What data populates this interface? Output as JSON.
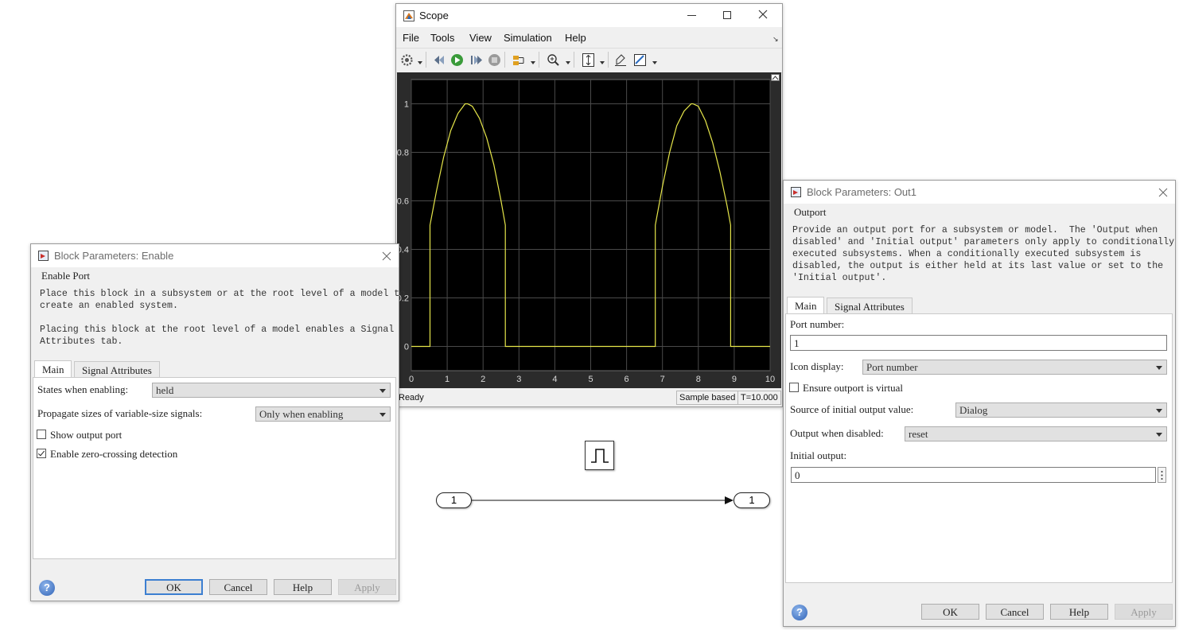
{
  "scope": {
    "title": "Scope",
    "menu": [
      "File",
      "Tools",
      "View",
      "Simulation",
      "Help"
    ],
    "status_left": "Ready",
    "status_mode": "Sample based",
    "status_time": "T=10.000"
  },
  "enable_dialog": {
    "title": "Block Parameters: Enable",
    "group": "Enable Port",
    "desc1": "Place this block in a subsystem or at the root level of a model to\ncreate an enabled system.",
    "desc2": "Placing this block at the root level of a model enables a Signal\nAttributes tab.",
    "tabs": [
      "Main",
      "Signal Attributes"
    ],
    "states_label": "States when enabling:",
    "states_value": "held",
    "propagate_label": "Propagate sizes of variable-size signals:",
    "propagate_value": "Only when enabling",
    "show_output_port": "Show output port",
    "show_output_port_checked": false,
    "zero_crossing": "Enable zero-crossing detection",
    "zero_crossing_checked": true,
    "buttons": {
      "ok": "OK",
      "cancel": "Cancel",
      "help": "Help",
      "apply": "Apply"
    }
  },
  "out_dialog": {
    "title": "Block Parameters: Out1",
    "group": "Outport",
    "desc": "Provide an output port for a subsystem or model.  The 'Output when\ndisabled' and 'Initial output' parameters only apply to conditionally\nexecuted subsystems. When a conditionally executed subsystem is\ndisabled, the output is either held at its last value or set to the\n'Initial output'.",
    "tabs": [
      "Main",
      "Signal Attributes"
    ],
    "port_number_label": "Port number:",
    "port_number_value": "1",
    "icon_display_label": "Icon display:",
    "icon_display_value": "Port number",
    "virtual_label": "Ensure outport is virtual",
    "virtual_checked": false,
    "source_label": "Source of initial output value:",
    "source_value": "Dialog",
    "disabled_label": "Output when disabled:",
    "disabled_value": "reset",
    "initial_label": "Initial output:",
    "initial_value": "0",
    "buttons": {
      "ok": "OK",
      "cancel": "Cancel",
      "help": "Help",
      "apply": "Apply"
    }
  },
  "canvas": {
    "inport_label": "1",
    "outport_label": "1"
  },
  "chart_data": {
    "type": "line",
    "title": "",
    "xlabel": "",
    "ylabel": "",
    "xlim": [
      0,
      10
    ],
    "ylim": [
      -0.1,
      1.1
    ],
    "xticks": [
      0,
      1,
      2,
      3,
      4,
      5,
      6,
      7,
      8,
      9,
      10
    ],
    "yticks": [
      0,
      0.2,
      0.4,
      0.6,
      0.8,
      1
    ],
    "ytick_labels": [
      "0",
      "0.2",
      "0.4",
      "0.6",
      "0.8",
      "1"
    ],
    "grid": true,
    "background": "#000000",
    "line_color": "#e6e64a",
    "series": [
      {
        "x": [
          0,
          0.52,
          0.52,
          0.7,
          0.9,
          1.1,
          1.3,
          1.5,
          1.57,
          1.7,
          1.9,
          2.1,
          2.3,
          2.5,
          2.62,
          2.62,
          6.8,
          6.8,
          7.0,
          7.2,
          7.4,
          7.6,
          7.8,
          7.85,
          8.0,
          8.2,
          8.4,
          8.6,
          8.8,
          8.9,
          8.9,
          10
        ],
        "y": [
          0,
          0,
          0.5,
          0.64,
          0.78,
          0.89,
          0.96,
          1.0,
          1.0,
          0.99,
          0.94,
          0.86,
          0.75,
          0.6,
          0.5,
          0,
          0,
          0.5,
          0.66,
          0.8,
          0.91,
          0.97,
          1.0,
          1.0,
          0.99,
          0.93,
          0.84,
          0.72,
          0.58,
          0.5,
          0,
          0
        ]
      }
    ]
  }
}
